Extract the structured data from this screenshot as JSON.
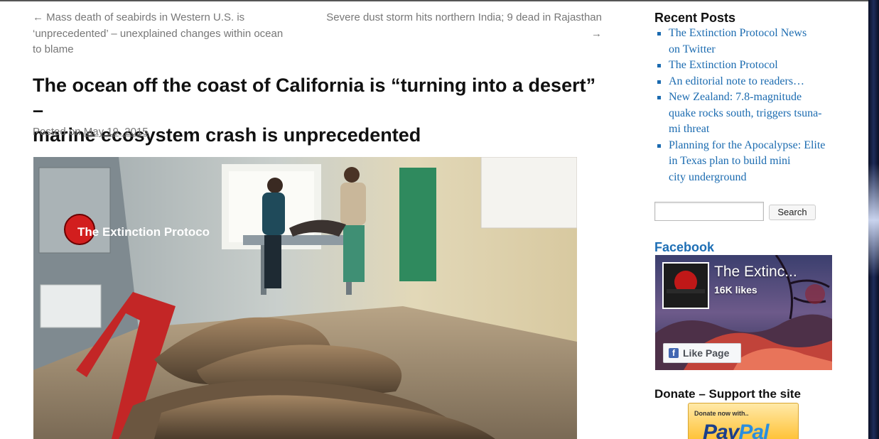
{
  "nav": {
    "prev_arrow": "←",
    "prev_line1": "Mass death of seabirds in Western U.S. is",
    "prev_line2": "‘unprecedented’ – unexplained changes within ocean",
    "prev_line3": "to blame",
    "next_line1": "Severe dust storm hits northern India; 9 dead in Rajasthan",
    "next_arrow": "→"
  },
  "post": {
    "title_line1": "The ocean off the coast of California is “turning into a desert” –",
    "title_line2": "marine ecosystem crash is unprecedented",
    "posted_label": "Posted on",
    "posted_date": "May 19, 2015",
    "image_watermark": "The Extinction Protoco"
  },
  "sidebar": {
    "recent_posts_title": "Recent Posts",
    "recent_posts": [
      {
        "line1": "The Extinction Protocol News",
        "line2": "on Twitter",
        "line3": ""
      },
      {
        "line1": "The Extinction Protocol",
        "line2": "",
        "line3": ""
      },
      {
        "line1": "An editorial note to readers…",
        "line2": "",
        "line3": ""
      },
      {
        "line1": "New Zealand: 7.8-magnitude",
        "line2": "quake rocks south, triggers tsuna-",
        "line3": "mi threat"
      },
      {
        "line1": "Planning for the Apocalypse: Elite",
        "line2": "in Texas plan to build mini",
        "line3": "city underground"
      }
    ],
    "search": {
      "placeholder": "",
      "button_label": "Search"
    },
    "facebook": {
      "title": "Facebook",
      "page_name": "The Extinc...",
      "likes": "16K likes",
      "like_button": "Like Page",
      "icon_glyph": "f"
    },
    "donate": {
      "title": "Donate – Support the site",
      "paypal_small": "Donate now with..",
      "paypal_logo_a": "Pay",
      "paypal_logo_b": "Pal"
    }
  },
  "colors": {
    "link": "#1b6bb0",
    "facebook_title": "#1e6fb5",
    "meta_text": "#777777"
  }
}
